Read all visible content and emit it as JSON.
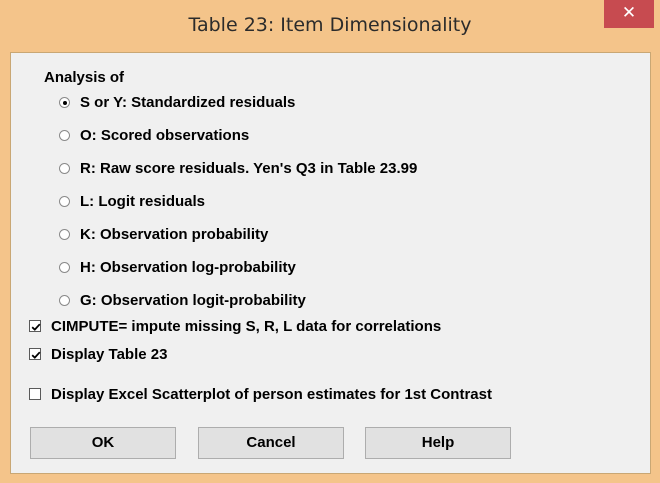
{
  "window": {
    "title": "Table 23: Item Dimensionality",
    "close_glyph": "✕"
  },
  "analysis": {
    "group_label": "Analysis of",
    "options": [
      {
        "label": "S or Y: Standardized residuals",
        "selected": true
      },
      {
        "label": "O: Scored observations",
        "selected": false
      },
      {
        "label": "R: Raw score residuals. Yen's Q3 in Table 23.99",
        "selected": false
      },
      {
        "label": "L: Logit residuals",
        "selected": false
      },
      {
        "label": "K: Observation probability",
        "selected": false
      },
      {
        "label": "H: Observation log-probability",
        "selected": false
      },
      {
        "label": "G: Observation logit-probability",
        "selected": false
      }
    ]
  },
  "checkboxes": [
    {
      "label": "CIMPUTE= impute missing S, R, L data for correlations",
      "checked": true
    },
    {
      "label": "Display Table 23",
      "checked": true
    },
    {
      "label": "Display Excel Scatterplot of person estimates for 1st Contrast",
      "checked": false
    }
  ],
  "buttons": {
    "ok": "OK",
    "cancel": "Cancel",
    "help": "Help"
  },
  "colors": {
    "titlebar": "#f4c48a",
    "close_button": "#c74b50",
    "client_bg": "#f0f0f0"
  }
}
